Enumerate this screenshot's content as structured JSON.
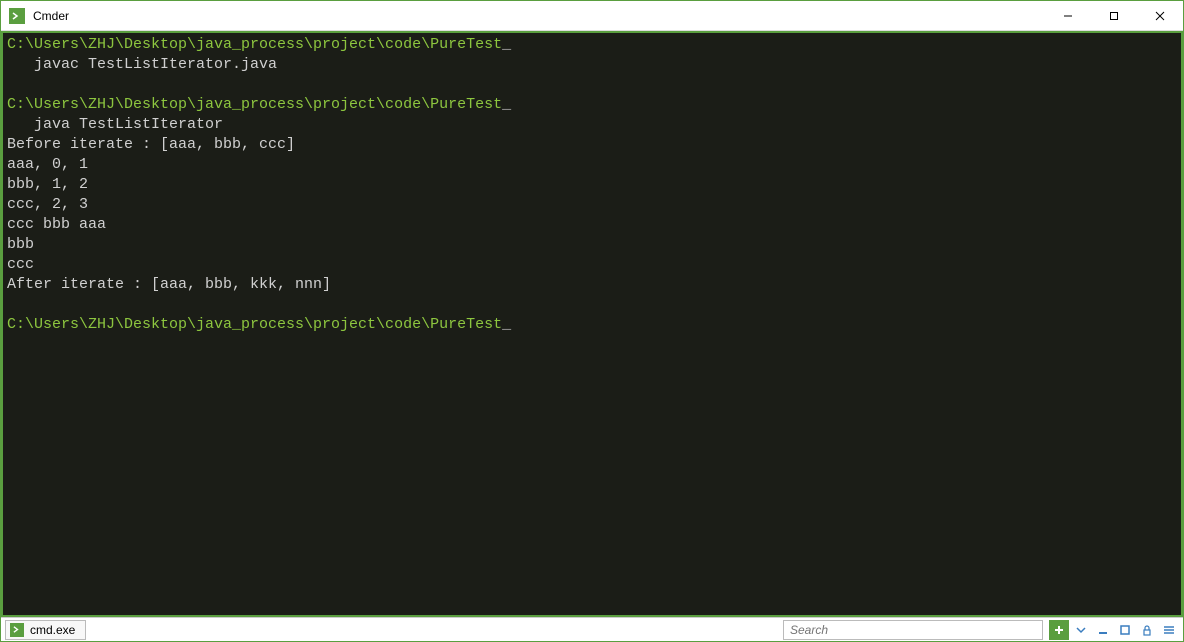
{
  "window": {
    "title": "Cmder"
  },
  "terminal": {
    "prompt1": "C:\\Users\\ZHJ\\Desktop\\java_process\\project\\code\\PureTest",
    "cmd1": "   javac TestListIterator.java",
    "prompt2": "C:\\Users\\ZHJ\\Desktop\\java_process\\project\\code\\PureTest",
    "cmd2": "   java TestListIterator",
    "out1": "Before iterate : [aaa, bbb, ccc]",
    "out2": "aaa, 0, 1",
    "out3": "bbb, 1, 2",
    "out4": "ccc, 2, 3",
    "out5": "ccc bbb aaa",
    "out6": "bbb",
    "out7": "ccc",
    "out8": "After iterate : [aaa, bbb, kkk, nnn]",
    "prompt3": "C:\\Users\\ZHJ\\Desktop\\java_process\\project\\code\\PureTest",
    "cursor": "_"
  },
  "statusbar": {
    "tab_label": "cmd.exe",
    "search_placeholder": "Search"
  }
}
